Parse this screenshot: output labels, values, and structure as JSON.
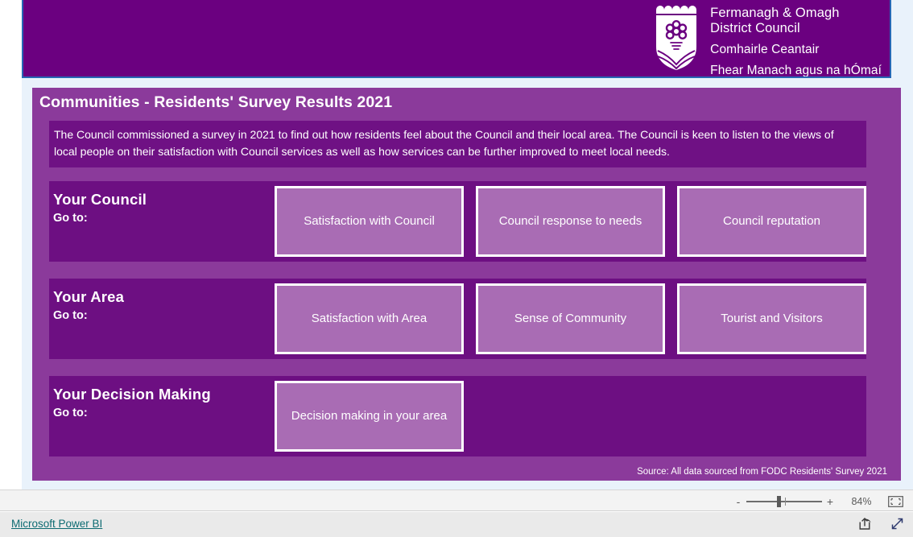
{
  "banner": {
    "logo_alt": "Fermanagh & Omagh District Council crest",
    "council_name_en_line1": "Fermanagh & Omagh",
    "council_name_en_line2": "District Council",
    "council_name_ga_line1": "Comhairle Ceantair",
    "council_name_ga_line2": "Fhear Manach agus na hÓmaí"
  },
  "report": {
    "title": "Communities - Residents' Survey Results 2021",
    "intro": "The Council commissioned a survey in 2021 to find out how residents feel about the Council and their local area. The Council is keen to listen to the views of local people on their satisfaction with Council services as well as how services can be further improved to meet local needs.",
    "source_note": "Source: All data sourced from FODC Residents' Survey 2021",
    "sections": [
      {
        "heading": "Your Council",
        "goto_label": "Go to:",
        "buttons": [
          "Satisfaction with Council",
          "Council response to needs",
          "Council reputation"
        ]
      },
      {
        "heading": "Your Area",
        "goto_label": "Go to:",
        "buttons": [
          "Satisfaction with Area",
          "Sense of Community",
          "Tourist and Visitors"
        ]
      },
      {
        "heading": "Your Decision Making",
        "goto_label": "Go to:",
        "buttons": [
          "Decision making in your area"
        ]
      }
    ]
  },
  "toolbar": {
    "zoom_out_label": "-",
    "zoom_in_label": "+",
    "zoom_level": "84%",
    "fit_to_page_icon": "fit-to-page-icon"
  },
  "statusbar": {
    "powerbi_link": "Microsoft Power BI",
    "share_icon": "share-icon",
    "fullscreen_icon": "fullscreen-icon"
  },
  "colors": {
    "banner_purple": "#6b0080",
    "canvas_purple": "#8b3a9b",
    "band_purple": "#6d0f82",
    "button_mauve": "#a96cb4",
    "page_background": "#e9f2fb",
    "link_teal": "#0d6b72"
  }
}
